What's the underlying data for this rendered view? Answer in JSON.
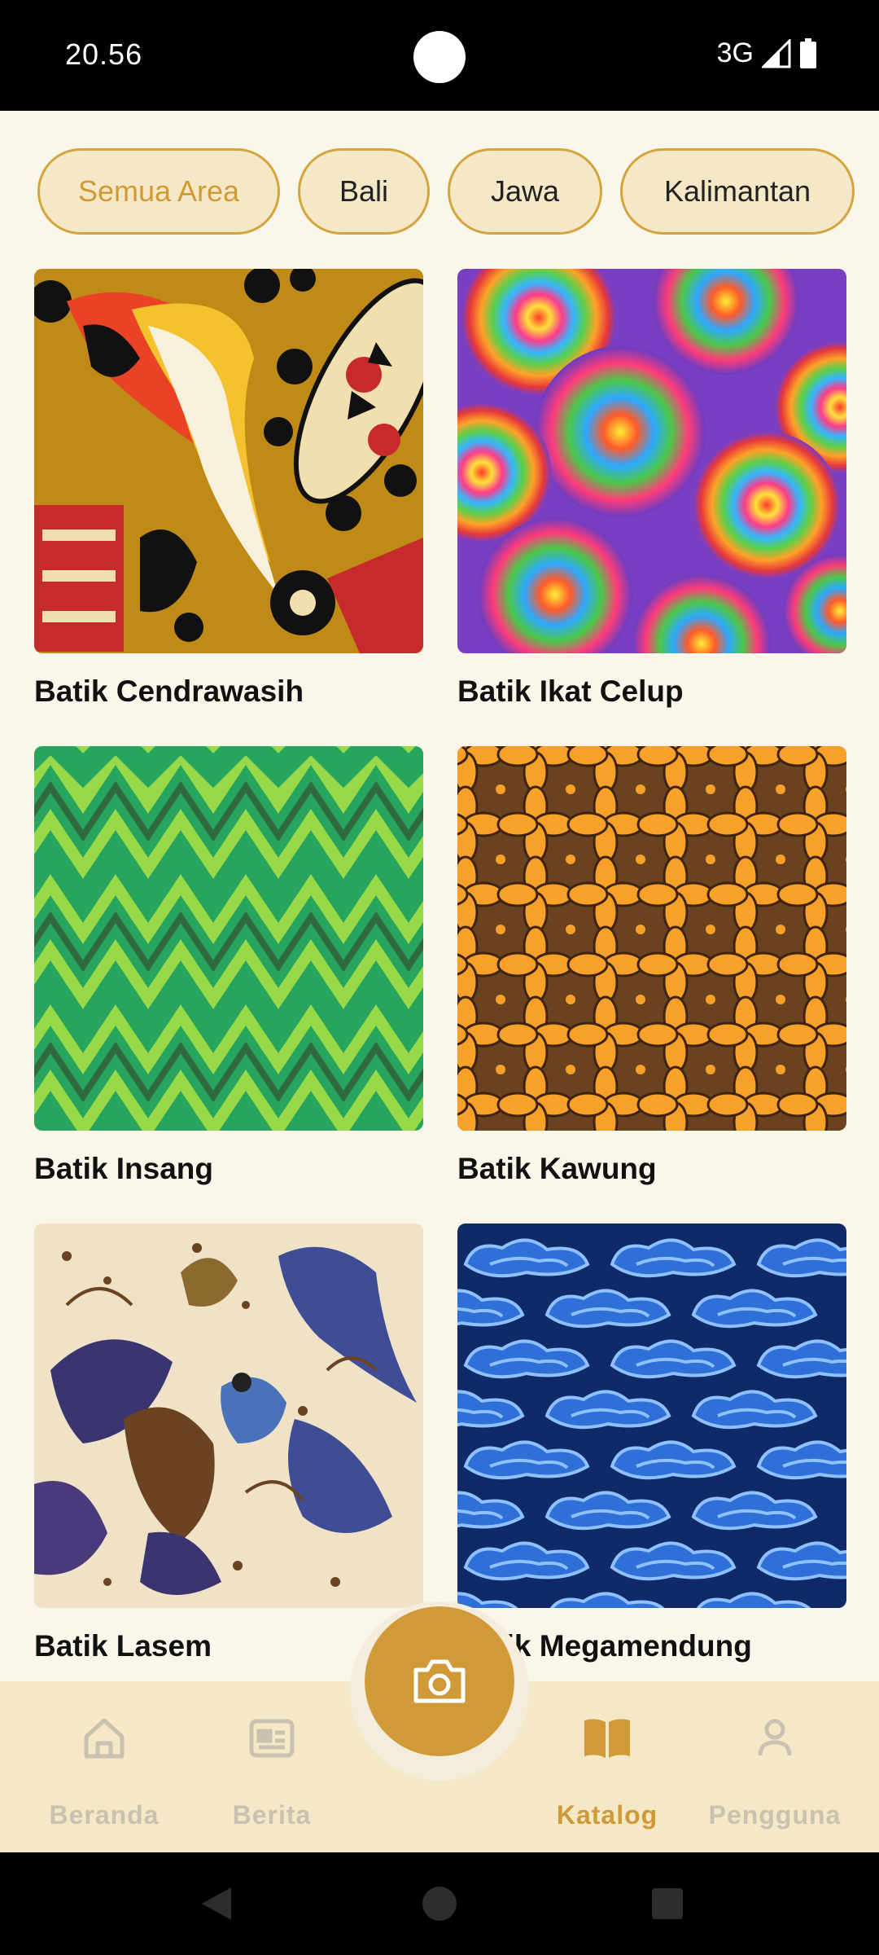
{
  "status_bar": {
    "time": "20.56",
    "network": "3G"
  },
  "filters": [
    {
      "label": "Semua Area",
      "active": true
    },
    {
      "label": "Bali",
      "active": false
    },
    {
      "label": "Jawa",
      "active": false
    },
    {
      "label": "Kalimantan",
      "active": false
    }
  ],
  "catalog": [
    {
      "name": "Batik Cendrawasih"
    },
    {
      "name": "Batik Ikat Celup"
    },
    {
      "name": "Batik Insang"
    },
    {
      "name": "Batik Kawung"
    },
    {
      "name": "Batik Lasem"
    },
    {
      "name": "Batik Megamendung"
    }
  ],
  "bottom_nav": {
    "items": [
      {
        "label": "Beranda",
        "icon": "home-icon",
        "active": false
      },
      {
        "label": "Berita",
        "icon": "news-icon",
        "active": false
      },
      {
        "label": "Katalog",
        "icon": "book-icon",
        "active": true
      },
      {
        "label": "Pengguna",
        "icon": "user-icon",
        "active": false
      }
    ],
    "fab_icon": "camera-icon"
  },
  "colors": {
    "accent": "#cf9a37",
    "chip_bg": "#f5e8c6",
    "page_bg": "#faf6ea",
    "inactive": "#c9c2b0"
  }
}
